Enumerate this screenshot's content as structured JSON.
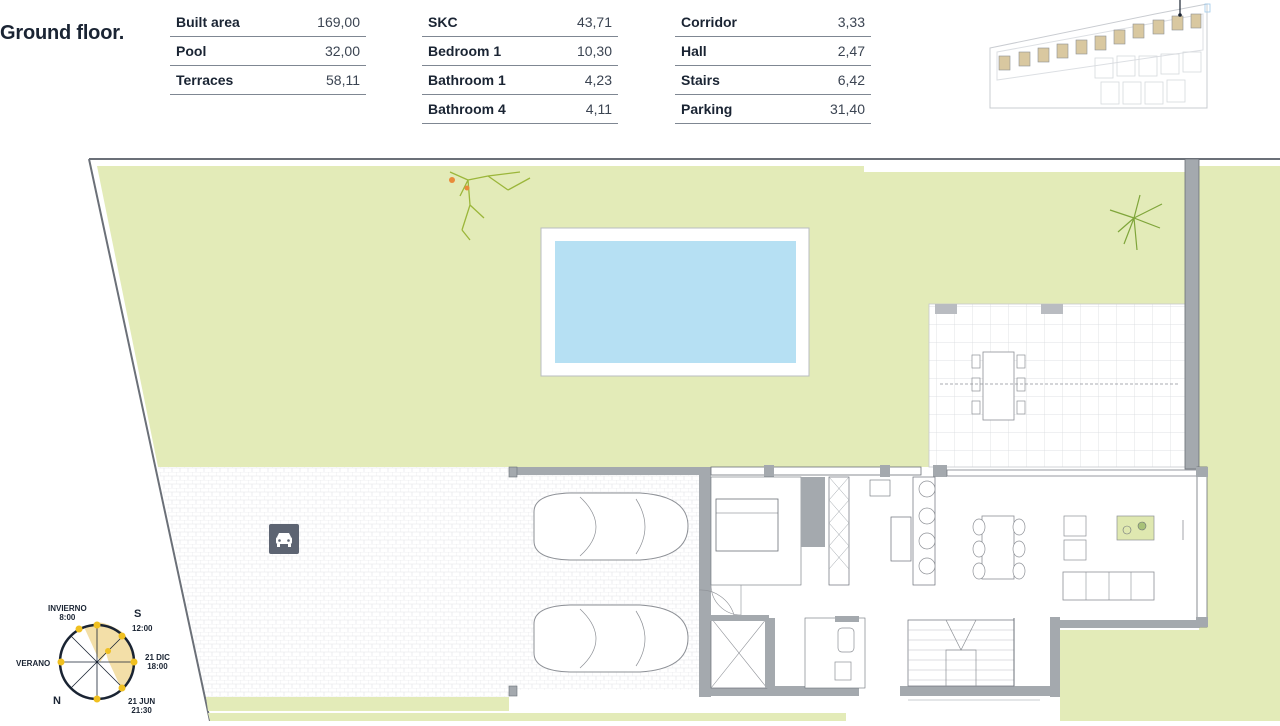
{
  "page": {
    "title": "Ground floor."
  },
  "areas": {
    "column1": [
      {
        "name": "Built area",
        "value": "169,00"
      },
      {
        "name": "Pool",
        "value": "32,00"
      },
      {
        "name": "Terraces",
        "value": "58,11"
      }
    ],
    "column2": [
      {
        "name": "SKC",
        "value": "43,71"
      },
      {
        "name": "Bedroom 1",
        "value": "10,30"
      },
      {
        "name": "Bathroom 1",
        "value": "4,23"
      },
      {
        "name": "Bathroom 4",
        "value": "4,11"
      }
    ],
    "column3": [
      {
        "name": "Corridor",
        "value": "3,33"
      },
      {
        "name": "Hall",
        "value": "2,47"
      },
      {
        "name": "Stairs",
        "value": "6,42"
      },
      {
        "name": "Parking",
        "value": "31,40"
      }
    ]
  },
  "sun_diagram": {
    "invierno": "INVIERNO",
    "invierno_time": "8:00",
    "s_label": "S",
    "s_time": "12:00",
    "verano": "VERANO",
    "dic": "21 DIC",
    "dic_time": "18:00",
    "jun": "21 JUN",
    "jun_time": "21:30",
    "n_label": "N"
  },
  "colors": {
    "garden": "#e3ebb8",
    "pool": "#b6e0f3",
    "wall": "#9aa0a6",
    "text": "#1a2433",
    "sun": "#f0c020"
  },
  "icons": {
    "parking": "car-icon",
    "plants": "palm-icon"
  }
}
